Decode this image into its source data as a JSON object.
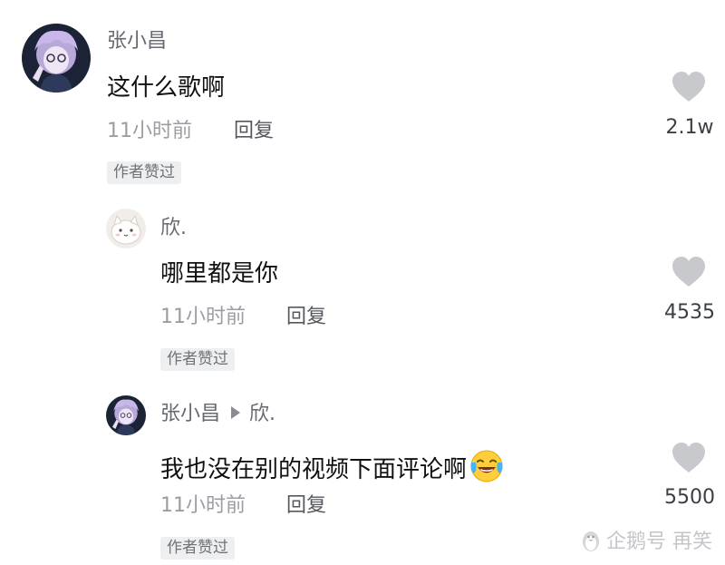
{
  "comments": [
    {
      "username": "张小昌",
      "text": "这什么歌啊",
      "time": "11小时前",
      "reply_label": "回复",
      "badge": "作者赞过",
      "like_count": "2.1w",
      "avatar": "anime-avatar-icon"
    },
    {
      "username": "欣.",
      "text": "哪里都是你",
      "time": "11小时前",
      "reply_label": "回复",
      "badge": "作者赞过",
      "like_count": "4535",
      "avatar": "cat-avatar-icon"
    },
    {
      "username": "张小昌",
      "reply_to": "欣.",
      "text": "我也没在别的视频下面评论啊",
      "emoji": "laugh-cry-emoji-icon",
      "time": "11小时前",
      "reply_label": "回复",
      "badge": "作者赞过",
      "like_count": "5500",
      "avatar": "anime-avatar-icon"
    }
  ],
  "watermark": {
    "text": "企鹅号 再笑",
    "icon": "penguin-logo-icon"
  },
  "colors": {
    "like_icon": "#c7c9cd",
    "username": "#666a70",
    "meta": "#9a9da3",
    "badge_bg": "#eeeff1"
  }
}
